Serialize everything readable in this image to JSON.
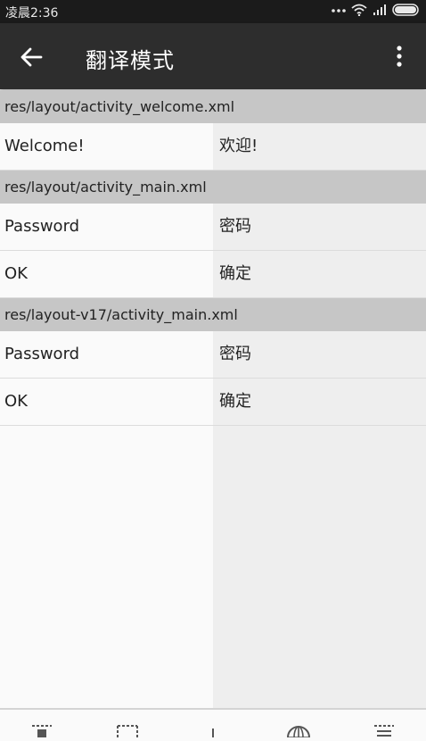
{
  "status_bar": {
    "time": "凌晨2:36",
    "icons": [
      "more-dots-icon",
      "wifi-icon",
      "signal-icon",
      "battery-icon"
    ]
  },
  "app_bar": {
    "back_icon": "arrow-left-icon",
    "title": "翻译模式",
    "more_icon": "more-vert-icon"
  },
  "sections": [
    {
      "file": "res/layout/activity_welcome.xml",
      "rows": [
        {
          "source": "Welcome!",
          "translation": "欢迎!"
        }
      ]
    },
    {
      "file": "res/layout/activity_main.xml",
      "rows": [
        {
          "source": "Password",
          "translation": "密码"
        },
        {
          "source": "OK",
          "translation": "确定"
        }
      ]
    },
    {
      "file": "res/layout-v17/activity_main.xml",
      "rows": [
        {
          "source": "Password",
          "translation": "密码"
        },
        {
          "source": "OK",
          "translation": "确定"
        }
      ]
    }
  ],
  "bottom_bar": {
    "icons": [
      "select-all-icon",
      "select-dashed-icon",
      "divider-icon",
      "globe-icon",
      "list-icon"
    ]
  },
  "colors": {
    "status_bar": "#1b1b1b",
    "app_bar": "#2d2d2d",
    "section_header": "#c6c6c6",
    "translation_column": "#eeeeee",
    "background": "#fafafa"
  }
}
